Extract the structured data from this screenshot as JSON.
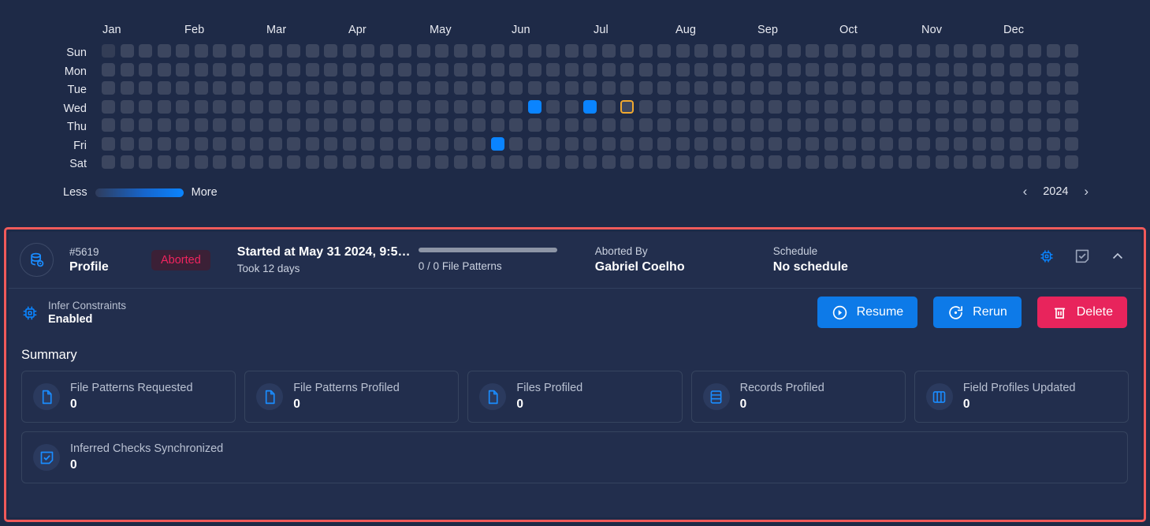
{
  "heatmap": {
    "months": [
      "Jan",
      "Feb",
      "Mar",
      "Apr",
      "May",
      "Jun",
      "Jul",
      "Aug",
      "Sep",
      "Oct",
      "Nov",
      "Dec"
    ],
    "weekdays": [
      "Sun",
      "Mon",
      "Tue",
      "Wed",
      "Thu",
      "Fri",
      "Sat"
    ],
    "legend_less": "Less",
    "legend_more": "More",
    "year": "2024",
    "prev_icon": "chevron-left-icon",
    "next_icon": "chevron-right-icon",
    "colors": {
      "empty": "#3c465f",
      "active": "#0a84ff",
      "selected_outline": "#f0a830",
      "background": "#1e2a47"
    },
    "active_cells": [
      {
        "week": 23,
        "day": 3
      },
      {
        "week": 26,
        "day": 3
      },
      {
        "week": 21,
        "day": 5
      }
    ],
    "selected_cell": {
      "week": 28,
      "day": 3
    }
  },
  "job": {
    "icon": "database-profile-icon",
    "id": "#5619",
    "type": "Profile",
    "status": "Aborted",
    "started": "Started at May 31 2024, 9:5…",
    "took": "Took 12 days",
    "progress_label": "0 / 0 File Patterns",
    "progress_percent": 0,
    "aborted_by_label": "Aborted By",
    "aborted_by_value": "Gabriel Coelho",
    "schedule_label": "Schedule",
    "schedule_value": "No schedule",
    "head_icons": [
      "chip-icon",
      "checked-document-icon",
      "chevron-up-icon"
    ],
    "infer_label": "Infer Constraints",
    "infer_value": "Enabled",
    "infer_icon": "chip-icon",
    "buttons": [
      {
        "label": "Resume",
        "icon": "play-circle-icon",
        "color": "#0d7ae8"
      },
      {
        "label": "Rerun",
        "icon": "rotate-left-icon",
        "color": "#0d7ae8"
      },
      {
        "label": "Delete",
        "icon": "trash-icon",
        "color": "#e8245c"
      }
    ],
    "summary_title": "Summary",
    "summary_cards": [
      {
        "label": "File Patterns Requested",
        "value": "0",
        "icon": "file-icon"
      },
      {
        "label": "File Patterns Profiled",
        "value": "0",
        "icon": "file-icon"
      },
      {
        "label": "Files Profiled",
        "value": "0",
        "icon": "file-icon"
      },
      {
        "label": "Records Profiled",
        "value": "0",
        "icon": "rows-icon"
      },
      {
        "label": "Field Profiles Updated",
        "value": "0",
        "icon": "columns-icon"
      }
    ],
    "summary_cards_row2": [
      {
        "label": "Inferred Checks Synchronized",
        "value": "0",
        "icon": "checked-box-icon"
      }
    ]
  }
}
